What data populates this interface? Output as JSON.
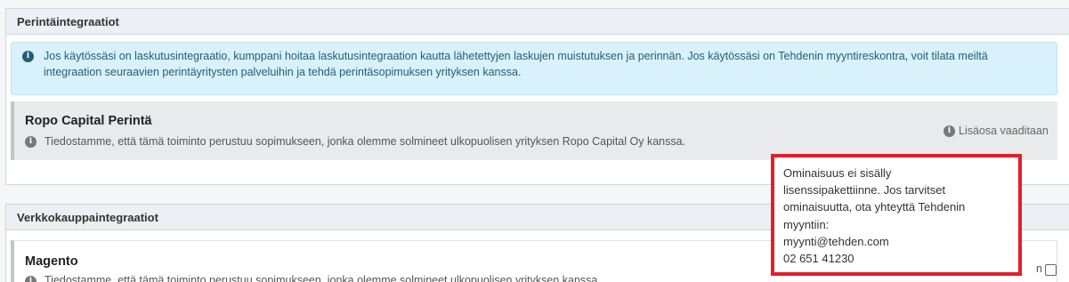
{
  "collection_panel": {
    "title": "Perintäintegraatiot",
    "info_line1": "Jos käytössäsi on laskutusintegraatio, kumppani hoitaa laskutusintegraation kautta lähetettyjen laskujen muistutuksen ja perinnän. Jos käytössäsi on Tehdenin myyntireskontra, voit tilata meiltä",
    "info_line2": "integraation seuraavien perintäyritysten palveluihin ja tehdä perintäsopimuksen yrityksen kanssa.",
    "ropo": {
      "title": "Ropo Capital Perintä",
      "description": "Tiedostamme, että tämä toiminto perustuu sopimukseen, jonka olemme solmineet ulkopuolisen yrityksen Ropo Capital Oy kanssa.",
      "addon_label": "Lisäosa vaaditaan"
    }
  },
  "ecommerce_panel": {
    "title": "Verkkokauppaintegraatiot",
    "magento": {
      "title": "Magento",
      "description": "Tiedostamme, että tämä toiminto perustuu sopimukseen, jonka olemme solmineet ulkopuolisen yrityksen kanssa.",
      "right_text": "n"
    }
  },
  "tooltip": {
    "line1": "Ominaisuus ei sisälly",
    "line2": "lisenssipakettiinne. Jos tarvitset",
    "line3": "ominaisuutta, ota yhteyttä Tehdenin",
    "line4": "myyntiin:",
    "email": "myynti@tehden.com",
    "phone": "02 651 41230"
  },
  "icons": {
    "info": "info-circle-icon"
  },
  "colors": {
    "tooltip_border": "#e0202a",
    "alert_background": "#d9f1fa",
    "alert_text": "#1f5f78"
  }
}
